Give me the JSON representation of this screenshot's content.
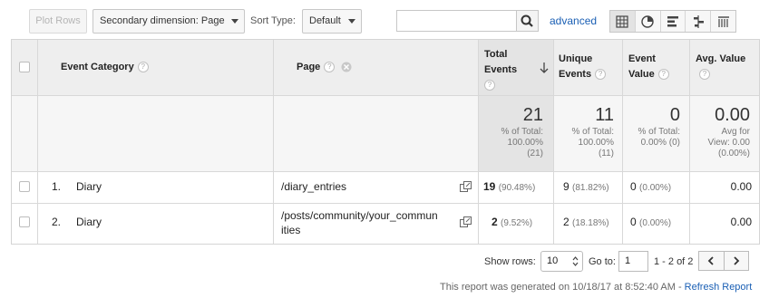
{
  "toolbar": {
    "plot_rows_label": "Plot Rows",
    "secondary_dimension_label": "Secondary dimension: Page",
    "sort_type_label": "Sort Type:",
    "sort_type_value": "Default",
    "search_value": "",
    "advanced_label": "advanced",
    "view_icons": [
      "table-view-icon",
      "pie-view-icon",
      "performance-view-icon",
      "comparison-view-icon",
      "pivot-view-icon"
    ]
  },
  "table": {
    "headers": {
      "event_category": "Event Category",
      "page": "Page",
      "total_events_line1": "Total",
      "total_events_line2": "Events",
      "unique_events_line1": "Unique",
      "unique_events_line2": "Events",
      "event_value_line1": "Event",
      "event_value_line2": "Value",
      "avg_value_line1": "Avg. Value"
    },
    "totals": {
      "total_events": "21",
      "total_events_sub1": "% of Total:",
      "total_events_sub2": "100.00%",
      "total_events_sub3": "(21)",
      "unique_events": "11",
      "unique_events_sub1": "% of Total:",
      "unique_events_sub2": "100.00%",
      "unique_events_sub3": "(11)",
      "event_value": "0",
      "event_value_sub1": "% of Total:",
      "event_value_sub2": "0.00% (0)",
      "avg_value": "0.00",
      "avg_value_sub1": "Avg for",
      "avg_value_sub2": "View: 0.00",
      "avg_value_sub3": "(0.00%)"
    },
    "rows": [
      {
        "index": "1.",
        "category": "Diary",
        "page_line1": "/diary_entries",
        "page_line2": "",
        "total_events": "19",
        "total_events_pct": "(90.48%)",
        "unique_events": "9",
        "unique_events_pct": "(81.82%)",
        "event_value": "0",
        "event_value_pct": "(0.00%)",
        "avg_value": "0.00"
      },
      {
        "index": "2.",
        "category": "Diary",
        "page_line1": "/posts/community/your_commun",
        "page_line2": "ities",
        "total_events": "2",
        "total_events_pct": "(9.52%)",
        "unique_events": "2",
        "unique_events_pct": "(18.18%)",
        "event_value": "0",
        "event_value_pct": "(0.00%)",
        "avg_value": "0.00"
      }
    ]
  },
  "footer": {
    "show_rows_label": "Show rows:",
    "show_rows_value": "10",
    "goto_label": "Go to:",
    "goto_value": "1",
    "range_text": "1 - 2 of 2",
    "report_text": "This report was generated on 10/18/17 at 8:52:40 AM - ",
    "refresh_label": "Refresh Report"
  }
}
